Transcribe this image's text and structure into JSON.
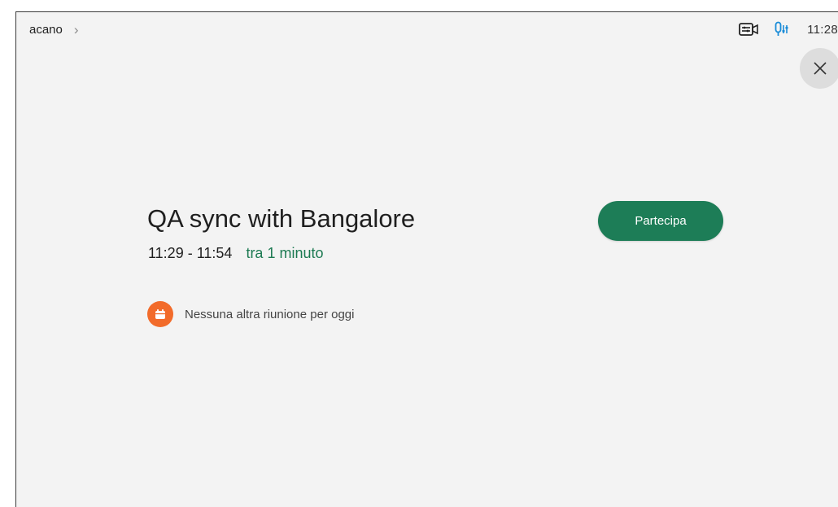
{
  "header": {
    "breadcrumb": "acano",
    "breadcrumb_chevron": "chevron-right-icon",
    "clock": "11:28",
    "camera_icon": "camera-settings-icon",
    "mic_icon": "microphone-settings-icon"
  },
  "meeting": {
    "title": "QA sync with Bangalore",
    "time_range": "11:29 - 11:54",
    "relative_time": "tra 1 minuto",
    "join_label": "Partecipa"
  },
  "info": {
    "message": "Nessuna altra riunione per oggi",
    "icon": "calendar-icon"
  },
  "colors": {
    "accent_green": "#1d7d57",
    "relative_time_green": "#1d7a52",
    "calendar_badge_orange": "#f26b2a",
    "mic_blue": "#1a8cd8",
    "background": "#f3f3f3"
  }
}
